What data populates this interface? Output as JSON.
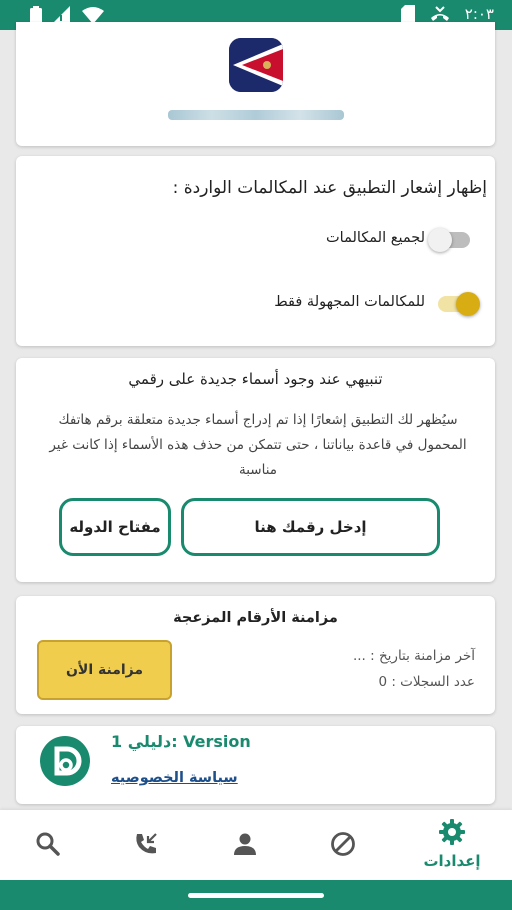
{
  "status_bar": {
    "time": "٢:٠٣",
    "icons": [
      "battery-icon",
      "signal-icon",
      "wifi-icon",
      "sd-card-icon",
      "call-forward-icon"
    ]
  },
  "app_header": {
    "flag_icon": "american-samoa-flag-icon"
  },
  "incoming_call_settings": {
    "title": "إظهار إشعار التطبيق عند المكالمات الواردة :",
    "option_all": {
      "label": "لجميع المكالمات",
      "enabled": false
    },
    "option_unknown": {
      "label": "للمكالمات المجهولة فقط",
      "enabled": true
    }
  },
  "new_names_alert": {
    "title": "تنبيهي عند وجود أسماء جديدة على رقمي",
    "description": "سيُظهر لك التطبيق إشعارًا إذا تم إدراج أسماء جديدة متعلقة برقم هاتفك المحمول في قاعدة بياناتنا ، حتى تتمكن من حذف هذه الأسماء إذا كانت غير مناسبة",
    "phone_button": "إدخل رقمك هنا",
    "country_button": "مفتاح الدوله"
  },
  "spam_sync": {
    "title": "مزامنة الأرقام المزعجة",
    "sync_button": "مزامنة الأن",
    "last_sync": "آخر مزامنة بتاريخ : ...",
    "records_count": "عدد السجلات : 0"
  },
  "about": {
    "version": "دليلي 1: Version",
    "privacy_link": "سياسة الخصوصيه"
  },
  "bottom_nav": {
    "items": [
      {
        "icon": "search-icon"
      },
      {
        "icon": "call-log-icon"
      },
      {
        "icon": "person-icon"
      },
      {
        "icon": "block-icon"
      },
      {
        "icon": "gear-icon",
        "label": "إعدادات",
        "active": true
      }
    ]
  },
  "colors": {
    "primary": "#1a8a6e",
    "accent": "#d8ad14",
    "sync_button": "#f0cd4c",
    "link": "#1d4f8a"
  }
}
